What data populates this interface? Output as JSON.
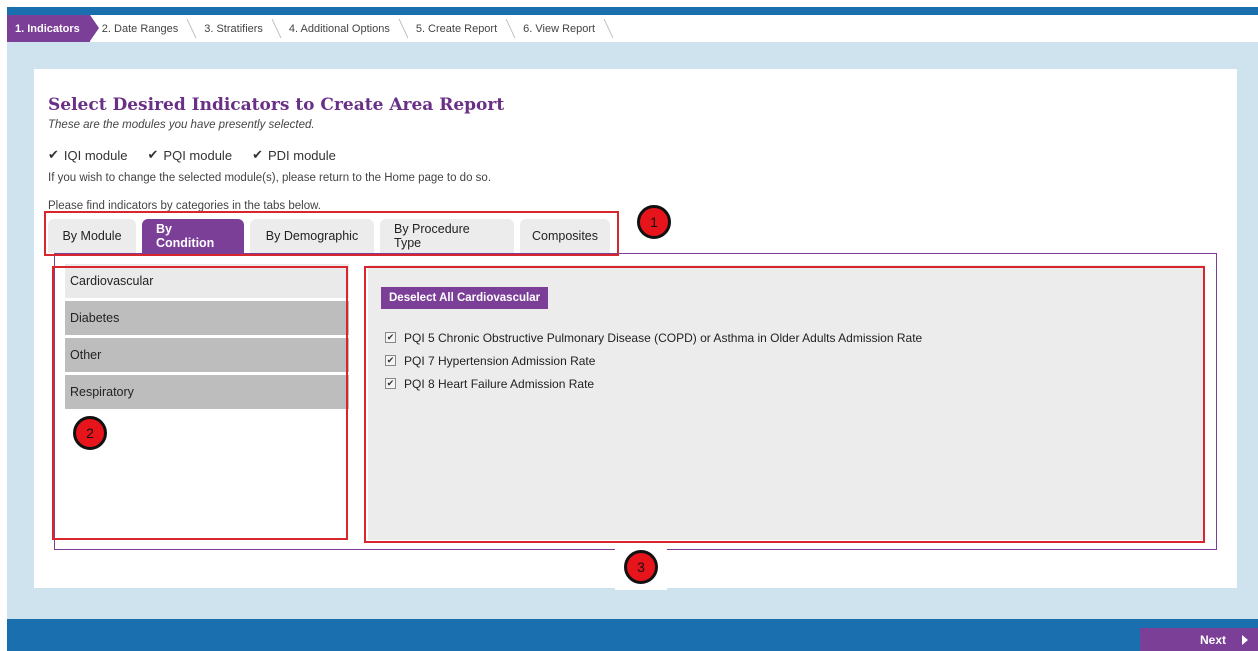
{
  "steps": [
    {
      "label": "1. Indicators",
      "active": true
    },
    {
      "label": "2. Date Ranges",
      "active": false
    },
    {
      "label": "3. Stratifiers",
      "active": false
    },
    {
      "label": "4. Additional Options",
      "active": false
    },
    {
      "label": "5. Create Report",
      "active": false
    },
    {
      "label": "6. View Report",
      "active": false
    }
  ],
  "page": {
    "title": "Select Desired Indicators to Create Area Report",
    "subtitle": "These are the modules you have presently selected.",
    "modules": [
      "IQI module",
      "PQI module",
      "PDI module"
    ],
    "change_note": "If you wish to change the selected module(s), please return to the Home page to do so.",
    "tabs_note": "Please find indicators by categories in the tabs below."
  },
  "tabs": [
    "By Module",
    "By Condition",
    "By Demographic",
    "By Procedure Type",
    "Composites"
  ],
  "active_tab": "By Condition",
  "categories": [
    "Cardiovascular",
    "Diabetes",
    "Other",
    "Respiratory"
  ],
  "active_category": "Cardiovascular",
  "content": {
    "deselect_label": "Deselect All Cardiovascular",
    "indicators": [
      {
        "label": "PQI 5 Chronic Obstructive Pulmonary Disease (COPD) or Asthma in Older Adults Admission Rate",
        "checked": true
      },
      {
        "label": "PQI 7 Hypertension Admission Rate",
        "checked": true
      },
      {
        "label": "PQI 8 Heart Failure Admission Rate",
        "checked": true
      }
    ]
  },
  "annotations": [
    "1",
    "2",
    "3"
  ],
  "footer": {
    "next_label": "Next"
  },
  "colors": {
    "accent": "#7b3f98",
    "header_blue": "#1a6fae",
    "stage_bg": "#cfe3ef",
    "annotation_red": "#e8141b"
  }
}
